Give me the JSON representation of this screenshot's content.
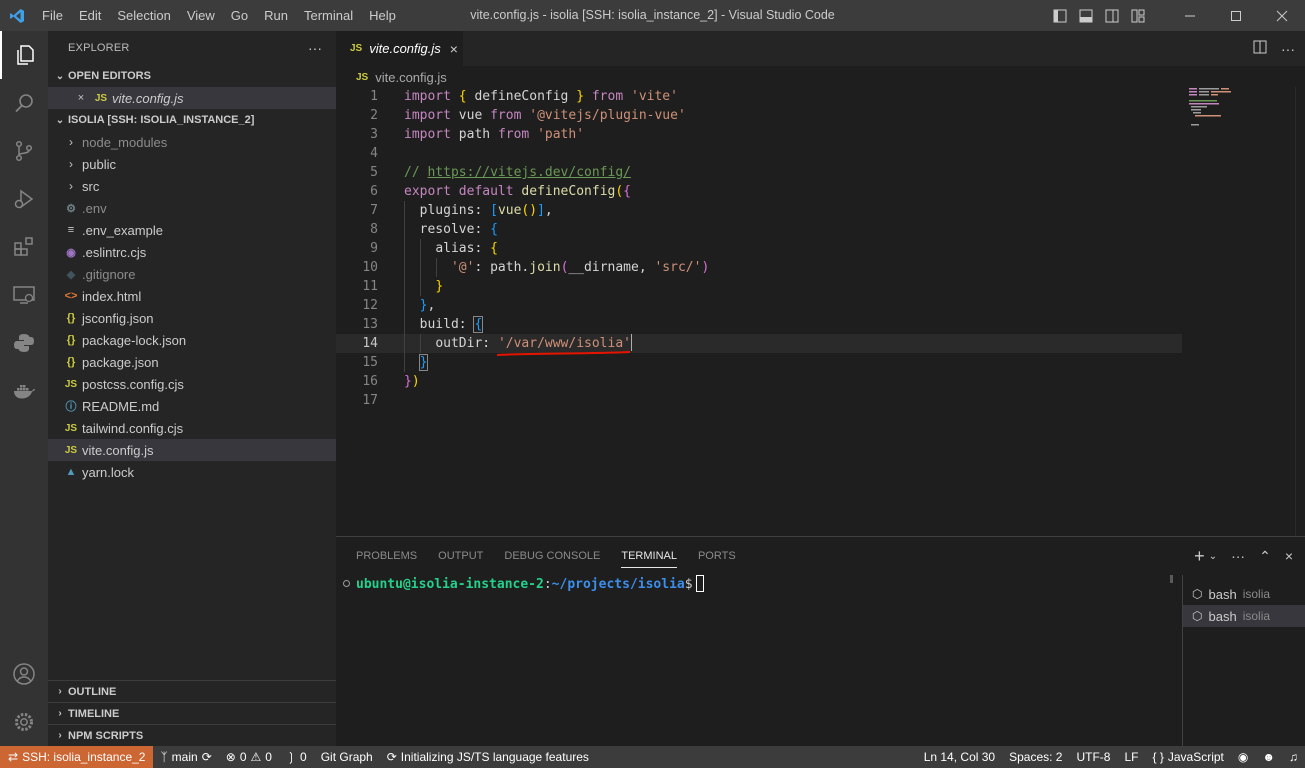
{
  "window": {
    "title": "vite.config.js - isolia [SSH: isolia_instance_2] - Visual Studio Code",
    "menu": [
      "File",
      "Edit",
      "Selection",
      "View",
      "Go",
      "Run",
      "Terminal",
      "Help"
    ]
  },
  "activity_bar": {
    "icons": [
      "explorer-icon",
      "search-icon",
      "source-control-icon",
      "run-debug-icon",
      "extensions-icon",
      "remote-explorer-icon",
      "python-icon",
      "docker-icon",
      "account-icon",
      "settings-gear-icon"
    ]
  },
  "sidebar": {
    "title": "EXPLORER",
    "more": "···",
    "open_editors_header": "OPEN EDITORS",
    "open_editors": [
      {
        "icon": "JS",
        "name": "vite.config.js"
      }
    ],
    "workspace_header": "ISOLIA [SSH: ISOLIA_INSTANCE_2]",
    "files": [
      {
        "type": "folder",
        "name": "node_modules",
        "icon": "›"
      },
      {
        "type": "folder",
        "name": "public",
        "icon": "›"
      },
      {
        "type": "folder",
        "name": "src",
        "icon": "›"
      },
      {
        "type": "file",
        "name": ".env",
        "icon": "⚙"
      },
      {
        "type": "file",
        "name": ".env_example",
        "icon": "≡"
      },
      {
        "type": "file",
        "name": ".eslintrc.cjs",
        "icon": "◉"
      },
      {
        "type": "file",
        "name": ".gitignore",
        "icon": "◆"
      },
      {
        "type": "file",
        "name": "index.html",
        "icon": "<>"
      },
      {
        "type": "file",
        "name": "jsconfig.json",
        "icon": "{}"
      },
      {
        "type": "file",
        "name": "package-lock.json",
        "icon": "{}"
      },
      {
        "type": "file",
        "name": "package.json",
        "icon": "{}"
      },
      {
        "type": "file",
        "name": "postcss.config.cjs",
        "icon": "JS"
      },
      {
        "type": "file",
        "name": "README.md",
        "icon": "ⓘ"
      },
      {
        "type": "file",
        "name": "tailwind.config.cjs",
        "icon": "JS"
      },
      {
        "type": "file",
        "name": "vite.config.js",
        "icon": "JS"
      },
      {
        "type": "file",
        "name": "yarn.lock",
        "icon": "▲"
      }
    ],
    "bottom_sections": [
      "OUTLINE",
      "TIMELINE",
      "NPM SCRIPTS"
    ]
  },
  "editor": {
    "tab": {
      "icon": "JS",
      "label": "vite.config.js",
      "close": "×"
    },
    "breadcrumb": {
      "icon": "JS",
      "label": "vite.config.js"
    },
    "current_line": 14,
    "lines": [
      "1",
      "2",
      "3",
      "4",
      "5",
      "6",
      "7",
      "8",
      "9",
      "10",
      "11",
      "12",
      "13",
      "14",
      "15",
      "16",
      "17"
    ]
  },
  "panel": {
    "tabs": [
      "PROBLEMS",
      "OUTPUT",
      "DEBUG CONSOLE",
      "TERMINAL",
      "PORTS"
    ],
    "active_tab": "TERMINAL",
    "prompt_user": "ubuntu@isolia-instance-2",
    "prompt_sep": ":",
    "prompt_path": "~/projects/isolia",
    "prompt_end": "$",
    "terminals": [
      {
        "name": "bash",
        "folder": "isolia"
      },
      {
        "name": "bash",
        "folder": "isolia"
      }
    ]
  },
  "statusbar": {
    "remote": "SSH: isolia_instance_2",
    "branch": "main",
    "errors": "0",
    "warnings": "0",
    "ports": "0",
    "git_graph": "Git Graph",
    "status_msg": "Initializing JS/TS language features",
    "position": "Ln 14, Col 30",
    "spaces": "Spaces: 2",
    "encoding": "UTF-8",
    "eol": "LF",
    "language_braces": "{ }",
    "language": "JavaScript"
  },
  "colors": {
    "remote_bg": "#cc6633",
    "annotation_underline": "#e51400"
  }
}
